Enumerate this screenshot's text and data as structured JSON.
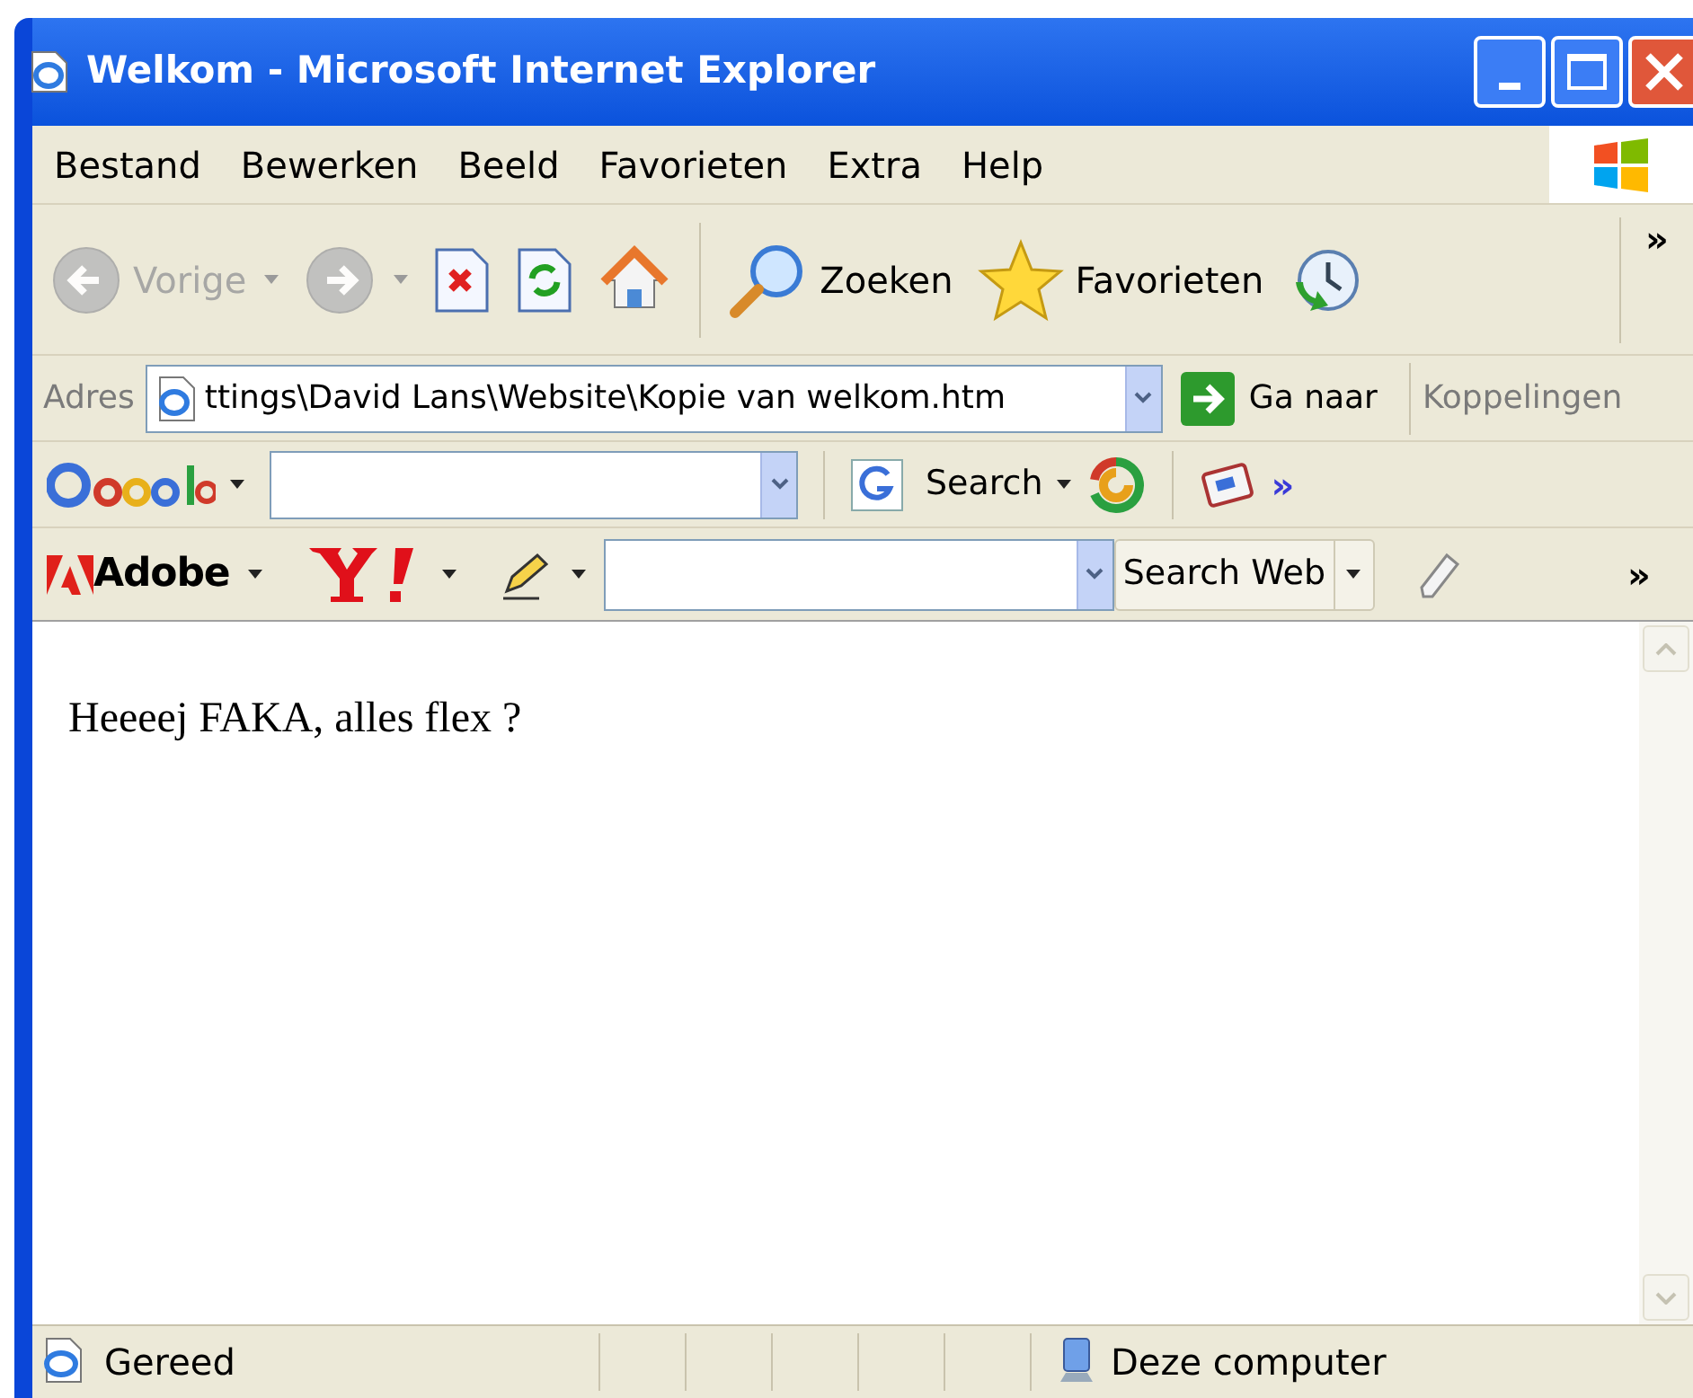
{
  "window": {
    "title": "Welkom - Microsoft Internet Explorer"
  },
  "menu": [
    "Bestand",
    "Bewerken",
    "Beeld",
    "Favorieten",
    "Extra",
    "Help"
  ],
  "toolbar": [
    {
      "kind": "back",
      "label": "Vorige",
      "disabled": true
    },
    {
      "kind": "forward",
      "disabled": true
    },
    {
      "kind": "stop",
      "disabled": false
    },
    {
      "kind": "refresh",
      "disabled": false
    },
    {
      "kind": "home",
      "disabled": false
    },
    {
      "kind": "search",
      "label": "Zoeken",
      "disabled": false
    },
    {
      "kind": "favorites",
      "label": "Favorieten",
      "disabled": false
    },
    {
      "kind": "history",
      "disabled": false
    }
  ],
  "toolbar_overflow": "»",
  "address_bar": {
    "label": "Adres",
    "value": "ttings\\David Lans\\Website\\Kopie van welkom.htm",
    "go": "Ga naar",
    "links": "Koppelingen"
  },
  "google_bar": {
    "search": "Search",
    "more": "»"
  },
  "adobe_bar": {
    "adobe": "Adobe",
    "search_web": "Search Web",
    "more": "»"
  },
  "page": {
    "text": "Heeeej FAKA, alles flex ?"
  },
  "status_bar": {
    "status": "Gereed",
    "zone": "Deze computer"
  }
}
